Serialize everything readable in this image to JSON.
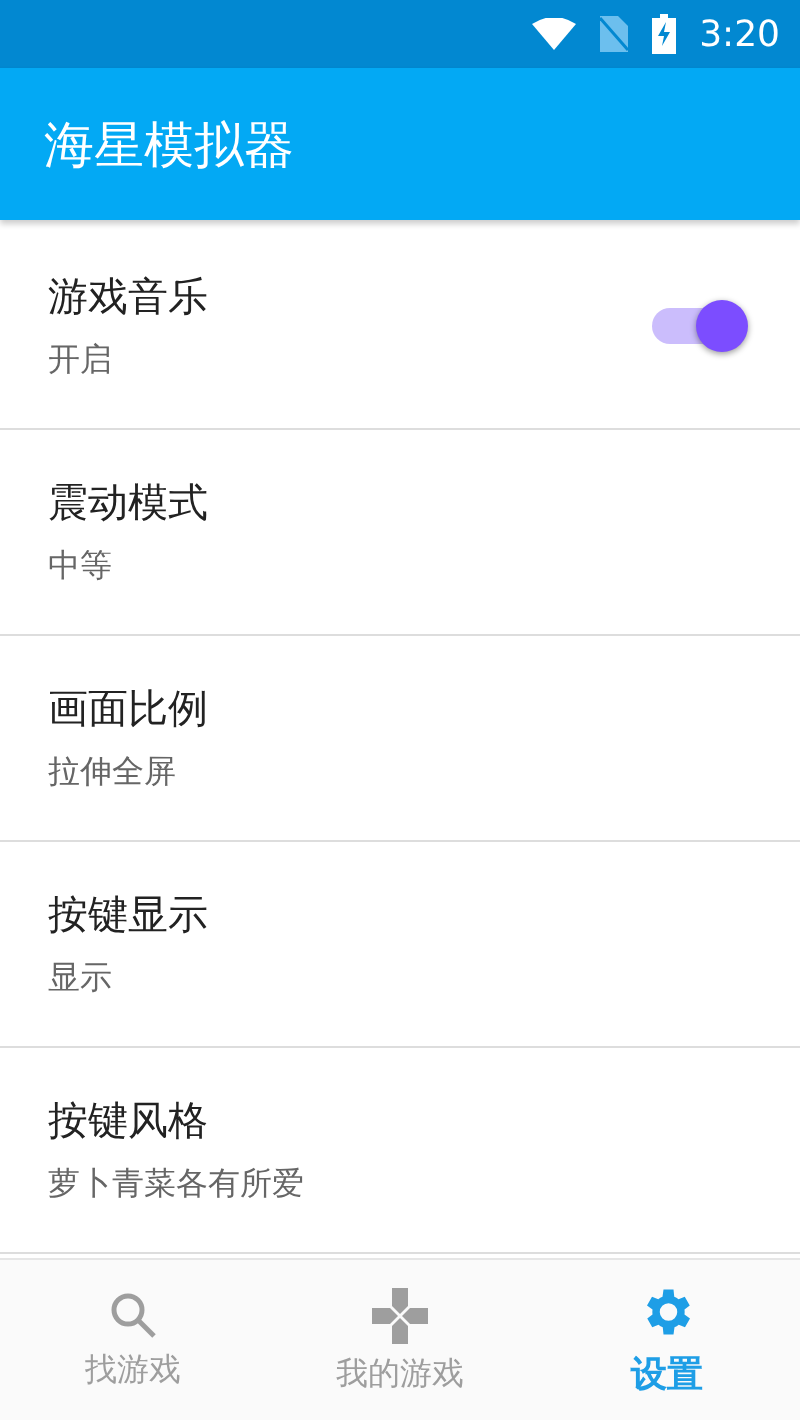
{
  "status_bar": {
    "time": "3:20"
  },
  "app_bar": {
    "title": "海星模拟器"
  },
  "settings": [
    {
      "kind": "switch",
      "title": "游戏音乐",
      "summary": "开启",
      "on": true
    },
    {
      "kind": "plain",
      "title": "震动模式",
      "summary": "中等"
    },
    {
      "kind": "plain",
      "title": "画面比例",
      "summary": "拉伸全屏"
    },
    {
      "kind": "plain",
      "title": "按键显示",
      "summary": "显示"
    },
    {
      "kind": "plain",
      "title": "按键风格",
      "summary": "萝卜青菜各有所爱"
    }
  ],
  "bottom_nav": [
    {
      "kind": "search",
      "label": "找游戏",
      "selected": false
    },
    {
      "kind": "gamepad",
      "label": "我的游戏",
      "selected": false
    },
    {
      "kind": "settings",
      "label": "设置",
      "selected": true
    }
  ]
}
